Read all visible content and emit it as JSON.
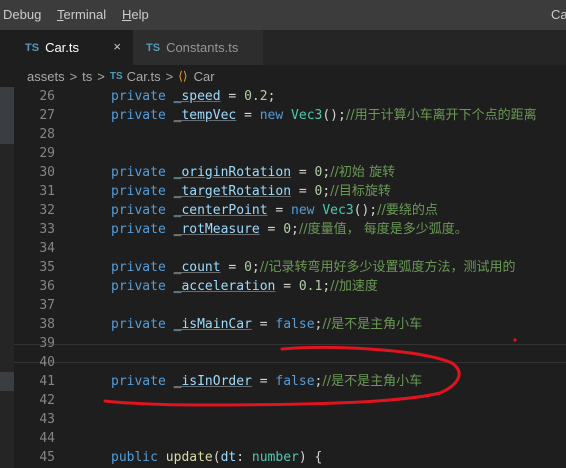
{
  "menu": {
    "debug": "Debug",
    "terminal_u": "T",
    "terminal_rest": "erminal",
    "help_u": "H",
    "help_rest": "elp",
    "window_title_fragment": "Ca"
  },
  "tabs": [
    {
      "badge": "TS",
      "name": "Car.ts",
      "close": "×"
    },
    {
      "badge": "TS",
      "name": "Constants.ts"
    }
  ],
  "breadcrumb": {
    "folder1": "assets",
    "folder2": "ts",
    "file_badge": "TS",
    "file": "Car.ts",
    "symbol": "Car",
    "sep": ">"
  },
  "lines": [
    {
      "n": "26",
      "p": [
        [
          "kw",
          "private "
        ],
        [
          "var",
          "_speed"
        ],
        [
          "op",
          " = "
        ],
        [
          "num",
          "0.2"
        ],
        [
          "op",
          ";"
        ]
      ]
    },
    {
      "n": "27",
      "p": [
        [
          "kw",
          "private "
        ],
        [
          "var",
          "_tempVec"
        ],
        [
          "op",
          " = "
        ],
        [
          "kw",
          "new "
        ],
        [
          "cls",
          "Vec3"
        ],
        [
          "op",
          "();"
        ],
        [
          "cm",
          "//用于计算小车离开下个点的距离"
        ]
      ]
    },
    {
      "n": "28",
      "p": []
    },
    {
      "n": "29",
      "p": []
    },
    {
      "n": "30",
      "p": [
        [
          "kw",
          "private "
        ],
        [
          "var",
          "_originRotation"
        ],
        [
          "op",
          " = "
        ],
        [
          "num",
          "0"
        ],
        [
          "op",
          ";"
        ],
        [
          "cm",
          "//初始 旋转"
        ]
      ]
    },
    {
      "n": "31",
      "p": [
        [
          "kw",
          "private "
        ],
        [
          "var",
          "_targetRotation"
        ],
        [
          "op",
          " = "
        ],
        [
          "num",
          "0"
        ],
        [
          "op",
          ";"
        ],
        [
          "cm",
          "//目标旋转"
        ]
      ]
    },
    {
      "n": "32",
      "p": [
        [
          "kw",
          "private "
        ],
        [
          "var",
          "_centerPoint"
        ],
        [
          "op",
          " = "
        ],
        [
          "kw",
          "new "
        ],
        [
          "cls",
          "Vec3"
        ],
        [
          "op",
          "();"
        ],
        [
          "cm",
          "//要绕的点"
        ]
      ]
    },
    {
      "n": "33",
      "p": [
        [
          "kw",
          "private "
        ],
        [
          "var",
          "_rotMeasure"
        ],
        [
          "op",
          " = "
        ],
        [
          "num",
          "0"
        ],
        [
          "op",
          ";"
        ],
        [
          "cm",
          "//度量值， 每度是多少弧度。"
        ]
      ]
    },
    {
      "n": "34",
      "p": []
    },
    {
      "n": "35",
      "p": [
        [
          "kw",
          "private "
        ],
        [
          "var",
          "_count"
        ],
        [
          "op",
          " = "
        ],
        [
          "num",
          "0"
        ],
        [
          "op",
          ";"
        ],
        [
          "cm",
          "//记录转弯用好多少设置弧度方法，测试用的"
        ]
      ]
    },
    {
      "n": "36",
      "p": [
        [
          "kw",
          "private "
        ],
        [
          "var",
          "_acceleration"
        ],
        [
          "op",
          " = "
        ],
        [
          "num",
          "0.1"
        ],
        [
          "op",
          ";"
        ],
        [
          "cm",
          "//加速度"
        ]
      ]
    },
    {
      "n": "37",
      "p": []
    },
    {
      "n": "38",
      "p": [
        [
          "kw",
          "private "
        ],
        [
          "var",
          "_isMainCar"
        ],
        [
          "op",
          " = "
        ],
        [
          "kw",
          "false"
        ],
        [
          "op",
          ";"
        ],
        [
          "cm",
          "//是不是主角小车"
        ]
      ]
    },
    {
      "n": "39",
      "p": []
    },
    {
      "n": "40",
      "p": []
    },
    {
      "n": "41",
      "p": [
        [
          "kw",
          "private "
        ],
        [
          "var",
          "_isInOrder"
        ],
        [
          "op",
          " = "
        ],
        [
          "kw",
          "false"
        ],
        [
          "op",
          ";"
        ],
        [
          "cm",
          "//是不是主角小车"
        ]
      ]
    },
    {
      "n": "42",
      "p": []
    },
    {
      "n": "43",
      "p": []
    },
    {
      "n": "44",
      "p": []
    },
    {
      "n": "45",
      "p": [
        [
          "kw",
          "public "
        ],
        [
          "fn",
          "update"
        ],
        [
          "op",
          "("
        ],
        [
          "par",
          "dt"
        ],
        [
          "op",
          ": "
        ],
        [
          "cls",
          "number"
        ],
        [
          "op",
          ") {"
        ]
      ]
    }
  ],
  "colors": {
    "annotation": "#e0141e",
    "keyword": "#569cd6",
    "comment": "#6a9955"
  }
}
